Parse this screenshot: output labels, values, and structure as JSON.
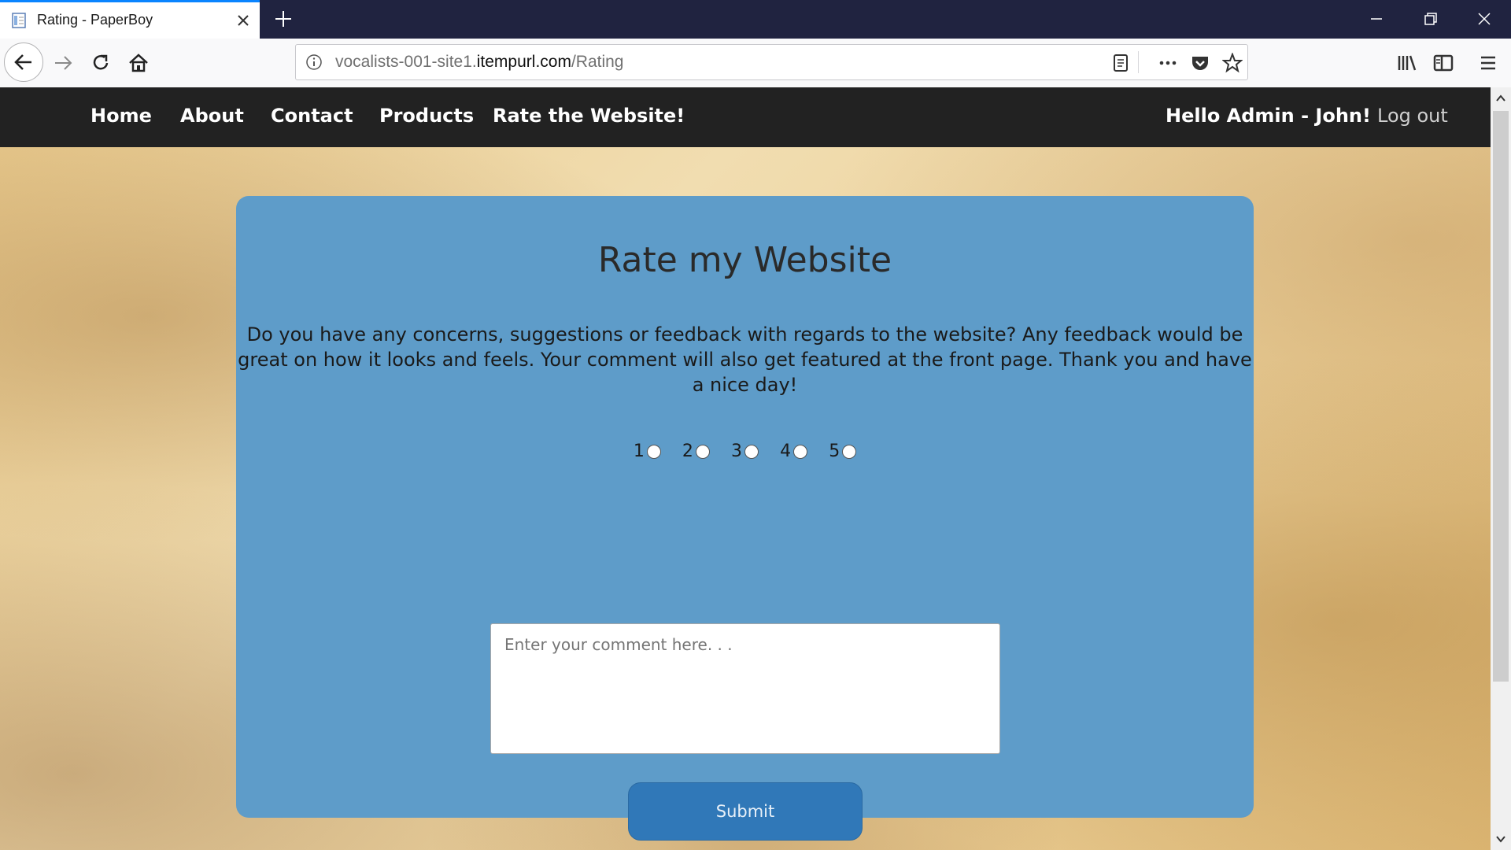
{
  "browser": {
    "tab_title": "Rating - PaperBoy",
    "url_prefix": "vocalists-001-site1.",
    "url_domain": "itempurl.com",
    "url_path": "/Rating",
    "accent_color": "#0a84ff"
  },
  "site_nav": {
    "links": [
      "Home",
      "About",
      "Contact",
      "Products",
      "Rate the Website!"
    ],
    "greeting": "Hello Admin - John!",
    "logout": "Log out"
  },
  "rating_form": {
    "title": "Rate my Website",
    "description": "Do you have any concerns, suggestions or feedback with regards to the website? Any feedback would be great on how it looks and feels. Your comment will also get featured at the front page. Thank you and have a nice day!",
    "options": [
      "1",
      "2",
      "3",
      "4",
      "5"
    ],
    "selected": null,
    "comment_placeholder": "Enter your comment here. . .",
    "comment_value": "",
    "submit_label": "Submit",
    "card_color": "#5e9cc9",
    "button_color": "#3078b8"
  }
}
